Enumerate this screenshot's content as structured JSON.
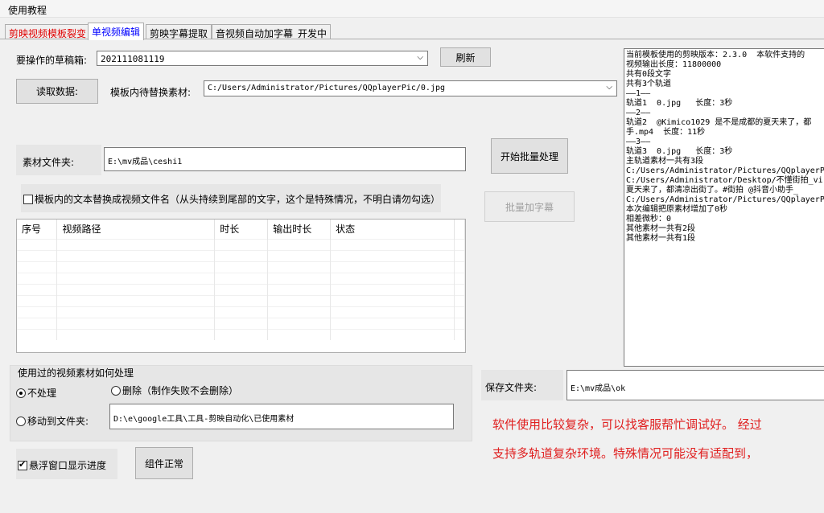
{
  "menu": {
    "tutorial": "使用教程"
  },
  "tabs": [
    {
      "label": "剪映视频模板裂变"
    },
    {
      "label": "单视频编辑"
    },
    {
      "label": "剪映字幕提取"
    },
    {
      "label": "音视频自动加字幕_开发中"
    }
  ],
  "draft": {
    "label": "要操作的草稿箱:",
    "value": "202111081119",
    "refresh": "刷新"
  },
  "read_data": "读取数据:",
  "replace": {
    "label": "模板内待替换素材:",
    "value": "C:/Users/Administrator/Pictures/QQplayerPic/0.jpg"
  },
  "material": {
    "label": "素材文件夹:",
    "value": "E:\\mv成品\\ceshi1"
  },
  "batch_process": "开始批量处理",
  "batch_subtitle": "批量加字幕",
  "rename_checkbox": "模板内的文本替换成视频文件名（从头持续到尾部的文字，这个是特殊情况，不明白请勿勾选）",
  "table": {
    "columns": [
      "序号",
      "视频路径",
      "时长",
      "输出时长",
      "状态"
    ]
  },
  "used": {
    "title": "使用过的视频素材如何处理",
    "no_process": "不处理",
    "delete": "删除（制作失败不会删除）",
    "move": "移动到文件夹:",
    "move_path": "D:\\e\\google工具\\工具-剪映自动化\\已使用素材"
  },
  "float_progress": "悬浮窗口显示进度",
  "component_ok": "组件正常",
  "save": {
    "label": "保存文件夹:",
    "value": "E:\\mv成品\\ok"
  },
  "notice": {
    "line1": "软件使用比较复杂，可以找客服帮忙调试好。 经过",
    "line2": "支持多轨道复杂环境。特殊情况可能没有适配到，"
  },
  "log": {
    "lines": [
      "当前模板使用的剪映版本：2.3.0  本软件支持的",
      "视频输出长度：11800000",
      "共有0段文字",
      "共有3个轨道",
      "——1——",
      "轨道1  0.jpg   长度：3秒",
      "",
      "——2——",
      "轨道2  @Kimico1029 是不是成都的夏天来了，都",
      "手.mp4  长度：11秒",
      "",
      "——3——",
      "轨道3  0.jpg   长度：3秒",
      "",
      "主轨道素材一共有3段",
      "C:/Users/Administrator/Pictures/QQplayerPic",
      "C:/Users/Administrator/Desktop/不懂街拍_vi",
      "夏天来了，都清凉出街了。#街拍 @抖音小助手_",
      "C:/Users/Administrator/Pictures/QQplayerPic",
      "本次编辑把原素材增加了0秒",
      "相差微秒：0",
      "其他素材一共有2段",
      "其他素材一共有1段"
    ]
  },
  "colors": {
    "tab_red": "#e00000",
    "tab_blue": "#0000ff",
    "notice_red": "#e02020"
  }
}
